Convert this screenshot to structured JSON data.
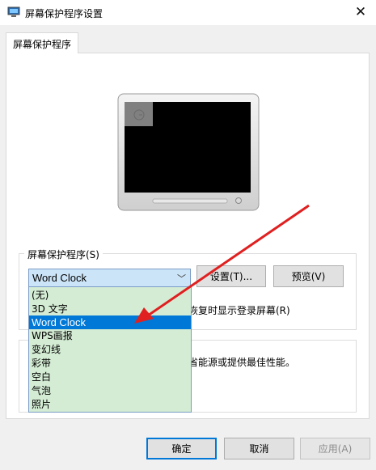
{
  "window": {
    "title": "屏幕保护程序设置",
    "close_glyph": "✕"
  },
  "tab": {
    "label": "屏幕保护程序"
  },
  "screensaver_group": {
    "label": "屏幕保护程序(S)",
    "selected": "Word Clock",
    "options": [
      "(无)",
      "3D 文字",
      "Word Clock",
      "WPS画报",
      "变幻线",
      "彩带",
      "空白",
      "气泡",
      "照片"
    ],
    "settings_button": "设置(T)...",
    "preview_button": "预览(V)",
    "resume_text": "恢复时显示登录屏幕(R)"
  },
  "power_group": {
    "text": "省能源或提供最佳性能。"
  },
  "footer": {
    "ok": "确定",
    "cancel": "取消",
    "apply": "应用(A)"
  },
  "colors": {
    "accent": "#0078d7",
    "dropdown_bg": "#d4ecd4",
    "arrow": "#e02020"
  }
}
